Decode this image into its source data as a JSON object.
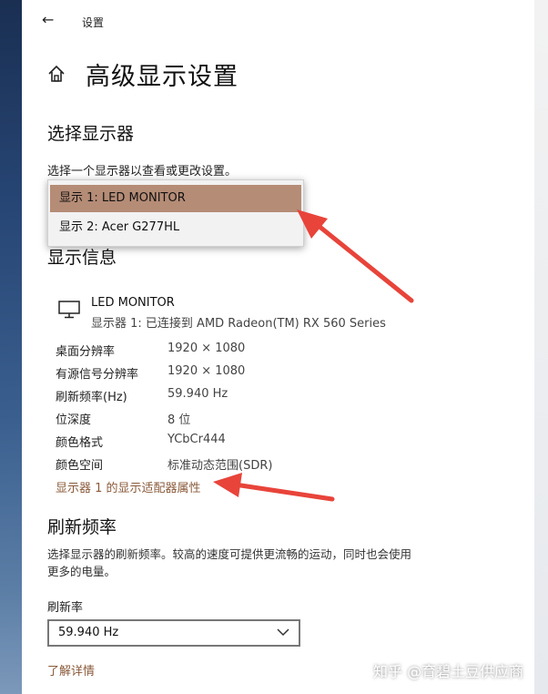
{
  "window": {
    "title": "设置",
    "back_icon": "back-arrow-icon"
  },
  "page": {
    "title": "高级显示设置",
    "home_icon": "home-icon"
  },
  "select_display": {
    "heading": "选择显示器",
    "description": "选择一个显示器以查看或更改设置。",
    "options": [
      "显示 1: LED MONITOR",
      "显示 2: Acer G277HL"
    ],
    "selected_index": 0
  },
  "display_info": {
    "heading": "显示信息",
    "monitor_name": "LED MONITOR",
    "monitor_status": "显示器 1: 已连接到 AMD Radeon(TM) RX 560 Series",
    "rows": [
      {
        "label": "桌面分辨率",
        "value": "1920 × 1080"
      },
      {
        "label": "有源信号分辨率",
        "value": "1920 × 1080"
      },
      {
        "label": "刷新频率(Hz)",
        "value": "59.940 Hz"
      },
      {
        "label": "位深度",
        "value": "8 位"
      },
      {
        "label": "颜色格式",
        "value": "YCbCr444"
      },
      {
        "label": "颜色空间",
        "value": "标准动态范围(SDR)"
      }
    ],
    "adapter_link": "显示器 1 的显示适配器属性"
  },
  "refresh": {
    "heading": "刷新频率",
    "description_line1": "选择显示器的刷新频率。较高的速度可提供更流畅的运动，同时也会使用",
    "description_line2": "更多的电量。",
    "label": "刷新率",
    "value": "59.940 Hz",
    "learn_more": "了解详情"
  },
  "watermark": "知乎 @育碧土豆供应商",
  "colors": {
    "selected_bg": "#b58c76",
    "link": "#8a5a3a",
    "arrow": "#e8443a"
  }
}
